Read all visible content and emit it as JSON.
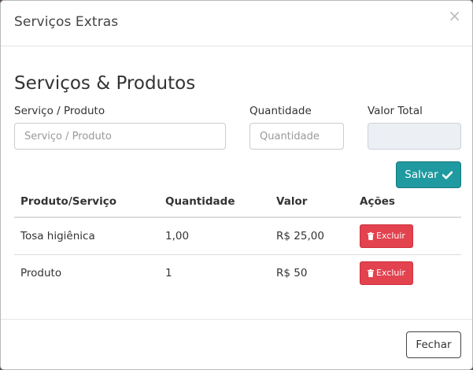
{
  "modal": {
    "title": "Serviços Extras",
    "close_symbol": "×"
  },
  "section": {
    "title": "Serviços & Produtos"
  },
  "form": {
    "service_label": "Serviço / Produto",
    "service_placeholder": "Serviço / Produto",
    "quantity_label": "Quantidade",
    "quantity_placeholder": "Quantidade",
    "total_label": "Valor Total",
    "total_value": "",
    "save_label": "Salvar",
    "save_icon": "check-icon"
  },
  "table": {
    "headers": [
      "Produto/Serviço",
      "Quantidade",
      "Valor",
      "Ações"
    ],
    "rows": [
      {
        "produto": "Tosa higiênica",
        "quantidade": "1,00",
        "valor": "R$ 25,00",
        "action": "Excluir"
      },
      {
        "produto": "Produto",
        "quantidade": "1",
        "valor": "R$ 50",
        "action": "Excluir"
      }
    ],
    "action_icon": "trash-icon",
    "colors": {
      "delete": "#e2434f"
    }
  },
  "footer": {
    "close_label": "Fechar"
  },
  "colors": {
    "primary": "#1f9aa0",
    "danger": "#e2434f"
  }
}
